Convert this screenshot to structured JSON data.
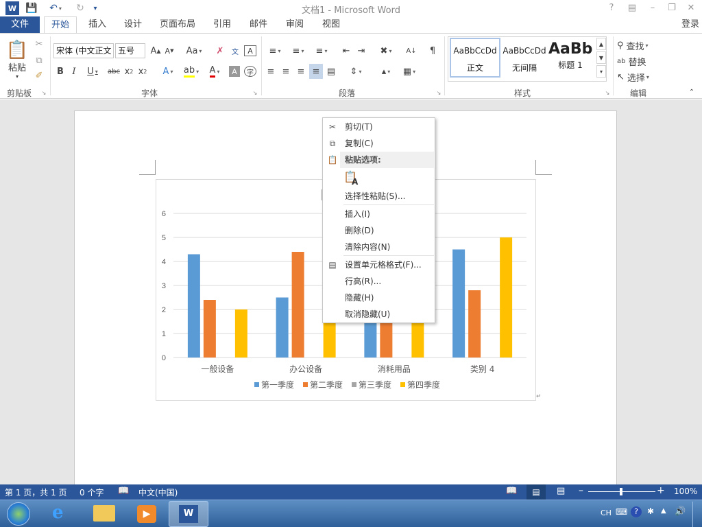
{
  "titlebar": {
    "title": "文档1 - Microsoft Word",
    "help": "?",
    "login": "登录"
  },
  "tabs": [
    "文件",
    "开始",
    "插入",
    "设计",
    "页面布局",
    "引用",
    "邮件",
    "审阅",
    "视图"
  ],
  "ribbon": {
    "clipboard": {
      "label": "剪贴板",
      "paste": "粘贴"
    },
    "font": {
      "label": "字体",
      "font_name": "宋体 (中文正文",
      "font_size": "五号",
      "case_btn": "Aa"
    },
    "paragraph": {
      "label": "段落"
    },
    "styles": {
      "label": "样式",
      "items": [
        {
          "preview": "AaBbCcDd",
          "name": "正文"
        },
        {
          "preview": "AaBbCcDd",
          "name": "无间隔"
        },
        {
          "preview": "AaBb",
          "name": "标题 1"
        }
      ]
    },
    "editing": {
      "label": "编辑",
      "find": "查找",
      "replace": "替换",
      "select": "选择"
    }
  },
  "chart_data": {
    "type": "bar",
    "categories": [
      "一般设备",
      "办公设备",
      "消耗用品",
      "类别 4"
    ],
    "series": [
      {
        "name": "第一季度",
        "values": [
          4.3,
          2.5,
          3.5,
          4.5
        ]
      },
      {
        "name": "第二季度",
        "values": [
          2.4,
          4.4,
          1.8,
          2.8
        ]
      },
      {
        "name": "第三季度",
        "values": [
          0,
          0,
          0,
          0
        ]
      },
      {
        "name": "第四季度",
        "values": [
          2,
          2,
          3,
          5
        ]
      }
    ],
    "ylim": [
      0,
      6
    ],
    "yticks": [
      0,
      1,
      2,
      3,
      4,
      5,
      6
    ],
    "colors": [
      "#5b9bd5",
      "#ed7d31",
      "#a5a5a5",
      "#ffc000"
    ],
    "grid": true,
    "legend": "bottom"
  },
  "context_menu": {
    "cut": "剪切(T)",
    "copy": "复制(C)",
    "paste_options": "粘贴选项:",
    "paste_special": "选择性粘贴(S)...",
    "insert": "插入(I)",
    "delete": "删除(D)",
    "clear": "清除内容(N)",
    "format_cells": "设置单元格格式(F)...",
    "row_height": "行高(R)...",
    "hide": "隐藏(H)",
    "unhide": "取消隐藏(U)"
  },
  "statusbar": {
    "page": "第 1 页，共 1 页",
    "words": "0 个字",
    "language": "中文(中国)",
    "zoom": "100%"
  },
  "taskbar": {
    "ime": "CH"
  },
  "colors": {
    "accent": "#2b579a"
  }
}
